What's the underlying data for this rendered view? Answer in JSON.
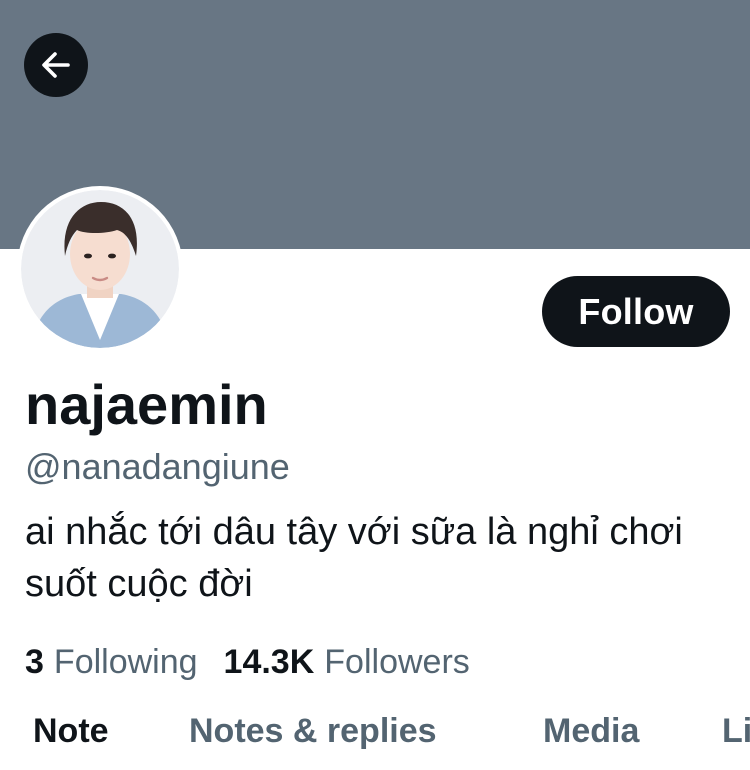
{
  "profile": {
    "display_name": "najaemin",
    "handle": "@nanadangiune",
    "bio": "ai nhắc tới dâu tây với sữa là nghỉ chơi suốt cuộc đời",
    "banner_color": "#687684"
  },
  "actions": {
    "back_icon": "arrow-left-icon",
    "follow_label": "Follow"
  },
  "stats": {
    "following_count": "3",
    "following_label": "Following",
    "followers_count": "14.3K",
    "followers_label": "Followers"
  },
  "tabs": [
    {
      "label": "Note",
      "active": true
    },
    {
      "label": "Notes & replies",
      "active": false
    },
    {
      "label": "Media",
      "active": false
    },
    {
      "label": "Li",
      "active": false
    }
  ],
  "colors": {
    "primary_text": "#0f1419",
    "secondary_text": "#536471",
    "button_bg": "#0f1419"
  }
}
